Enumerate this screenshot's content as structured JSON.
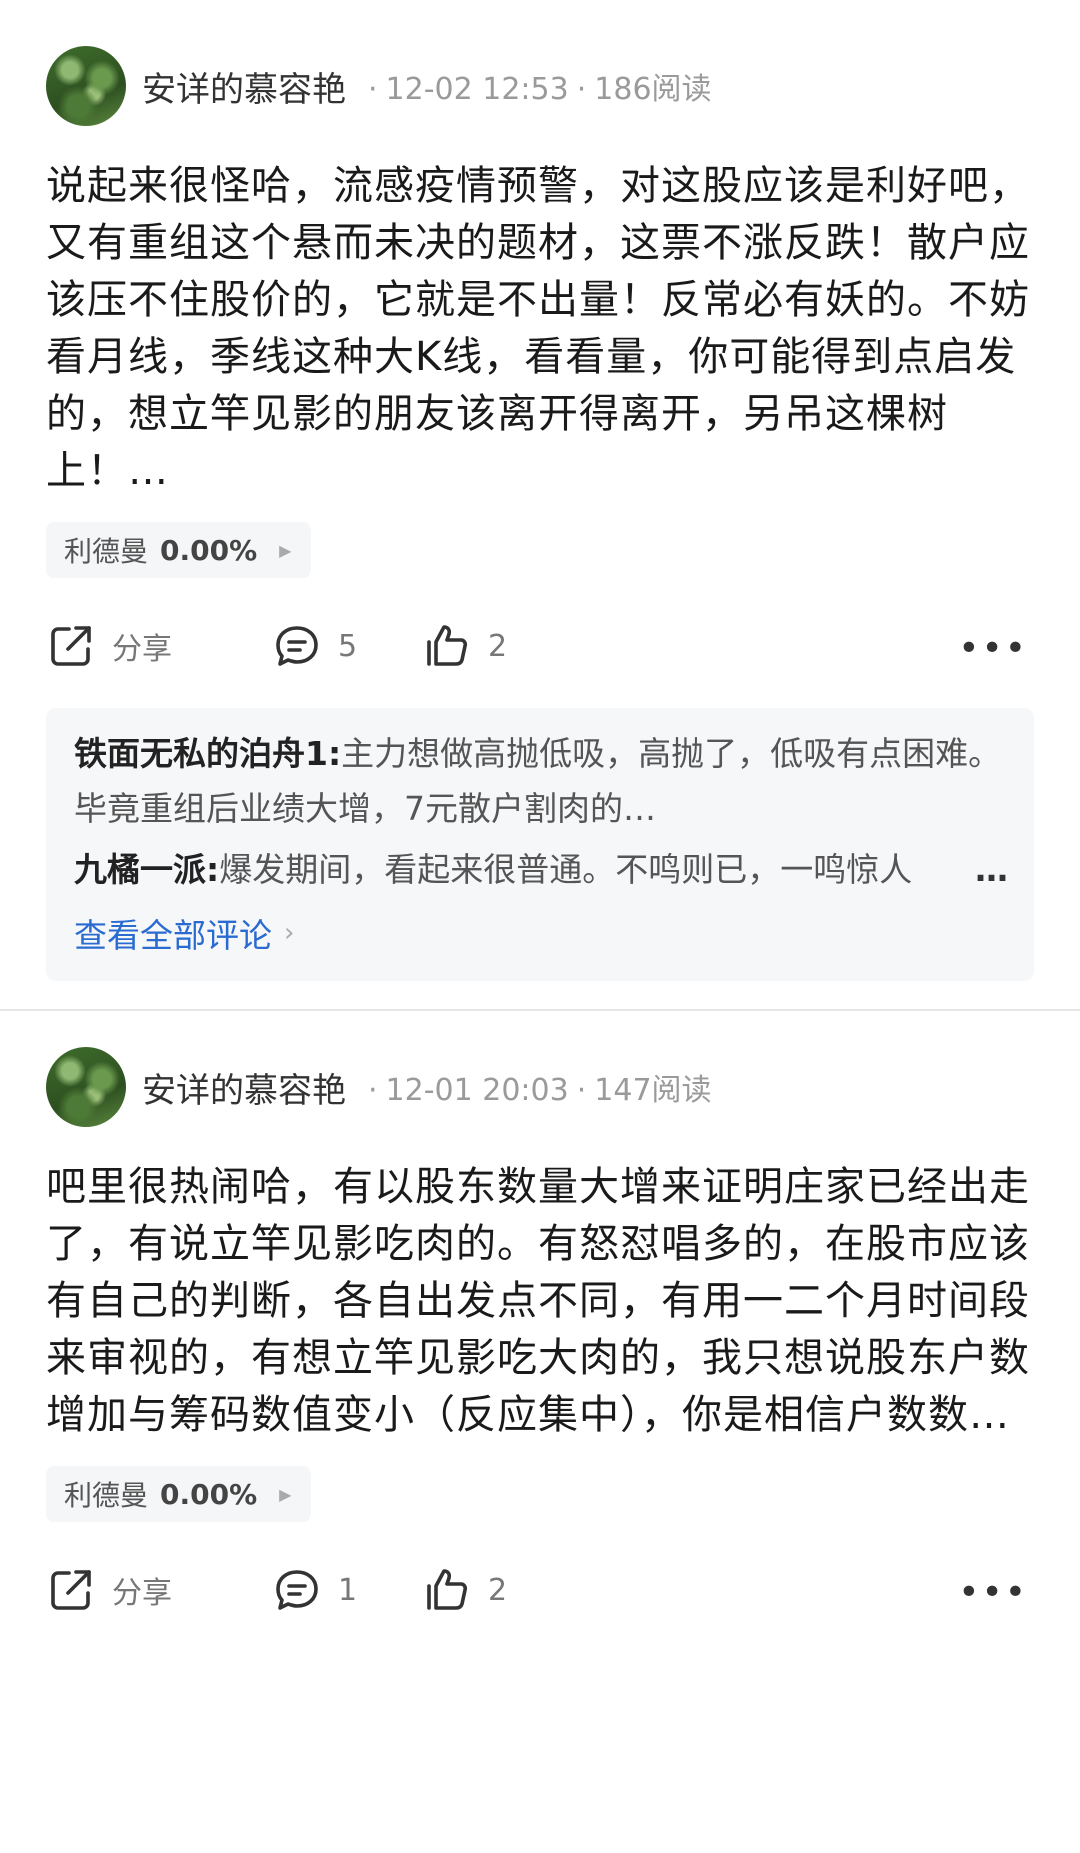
{
  "posts": [
    {
      "author": "安详的慕容艳",
      "date": "12-02 12:53",
      "reads": "186阅读",
      "body": "说起来很怪哈，流感疫情预警，对这股应该是利好吧，又有重组这个悬而未决的题材，这票不涨反跌！散户应该压不住股价的，它就是不出量！反常必有妖的。不妨看月线，季线这种大K线，看看量，你可能得到点启发的，想立竿见影的朋友该离开得离开，另吊这棵树上！…",
      "stock": {
        "name": "利德曼",
        "change": "0.00%"
      },
      "actions": {
        "share": "分享",
        "comments": "5",
        "likes": "2"
      },
      "comments": [
        {
          "name": "铁面无私的泊舟1:",
          "text": "主力想做高抛低吸，高抛了，低吸有点困难。毕竟重组后业绩大增，7元散户割肉的…"
        },
        {
          "name": "九橘一派:",
          "text": "爆发期间，看起来很普通。不鸣则已，一鸣惊人"
        }
      ],
      "view_all": "查看全部评论"
    },
    {
      "author": "安详的慕容艳",
      "date": "12-01 20:03",
      "reads": "147阅读",
      "body": "吧里很热闹哈，有以股东数量大增来证明庄家已经出走了，有说立竿见影吃肉的。有怒怼唱多的，在股市应该有自己的判断，各自出发点不同，有用一二个月时间段来审视的，有想立竿见影吃大肉的，我只想说股东户数增加与筹码数值变小（反应集中），你是相信户数数…",
      "stock": {
        "name": "利德曼",
        "change": "0.00%"
      },
      "actions": {
        "share": "分享",
        "comments": "1",
        "likes": "2"
      }
    }
  ],
  "icons": {
    "share": "share-icon",
    "comment": "comment-icon",
    "like": "thumbs-up-icon",
    "more": "more-dots-icon"
  }
}
